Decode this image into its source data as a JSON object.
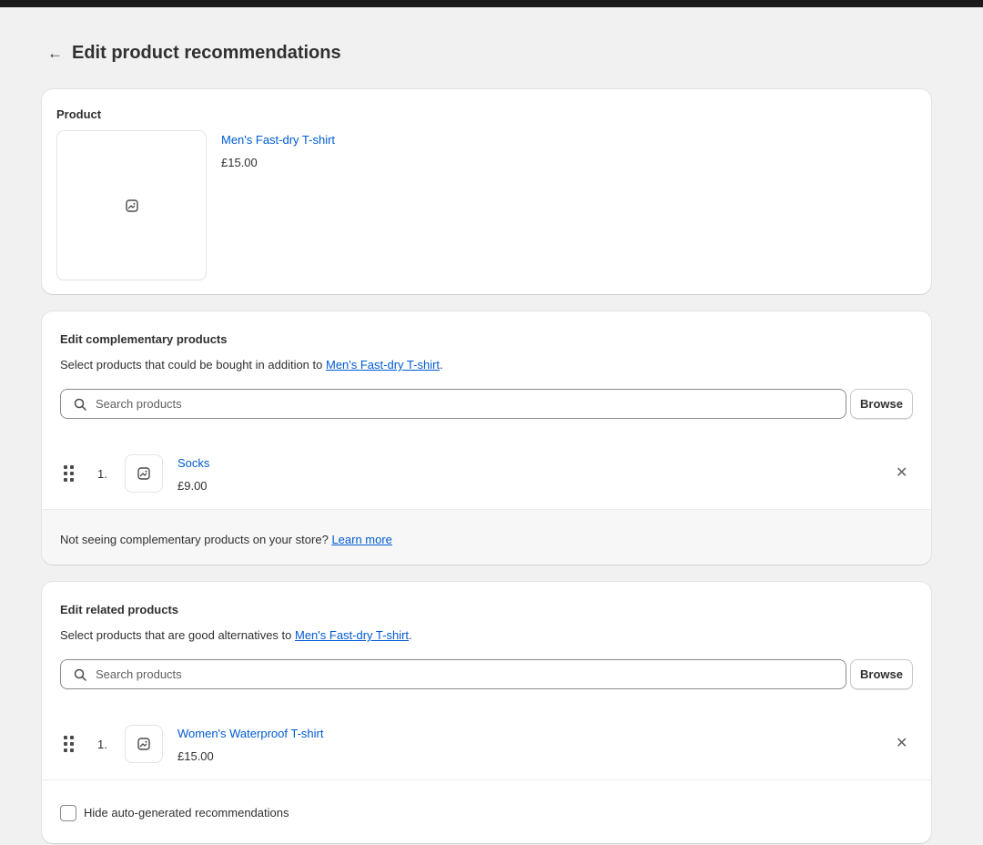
{
  "header": {
    "back_icon": "arrow-left-icon",
    "title": "Edit product recommendations"
  },
  "product_card": {
    "label": "Product",
    "product_name": "Men's Fast-dry T-shirt",
    "product_price": "£15.00",
    "image_icon": "image-placeholder-icon"
  },
  "complementary": {
    "title": "Edit complementary products",
    "desc_prefix": "Select products that could be bought in addition to ",
    "desc_link": "Men's Fast-dry T-shirt",
    "desc_suffix": ".",
    "search_placeholder": "Search products",
    "browse_label": "Browse",
    "items": [
      {
        "index": "1.",
        "name": "Socks",
        "price": "£9.00"
      }
    ],
    "footer_prefix": "Not seeing complementary products on your store? ",
    "footer_link": "Learn more"
  },
  "related": {
    "title": "Edit related products",
    "desc_prefix": "Select products that are good alternatives to ",
    "desc_link": "Men's Fast-dry T-shirt",
    "desc_suffix": ".",
    "search_placeholder": "Search products",
    "browse_label": "Browse",
    "items": [
      {
        "index": "1.",
        "name": "Women's Waterproof T-shirt",
        "price": "£15.00"
      }
    ],
    "checkbox_label": "Hide auto-generated recommendations",
    "checkbox_checked": false
  },
  "colors": {
    "link": "#005bd3",
    "background": "#f1f1f1",
    "topbar": "#1a1a1a"
  }
}
